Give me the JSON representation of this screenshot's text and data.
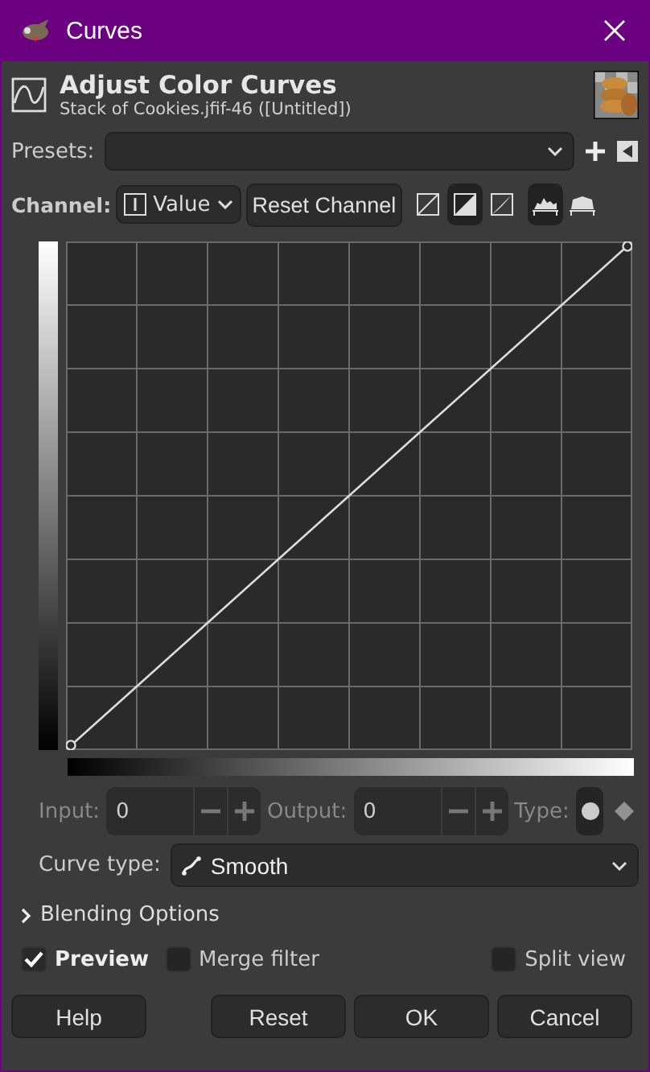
{
  "window": {
    "title": "Curves"
  },
  "header": {
    "title": "Adjust Color Curves",
    "subtitle": "Stack of Cookies.jfif-46 ([Untitled])"
  },
  "presets": {
    "label": "Presets:"
  },
  "channel": {
    "label": "Channel:",
    "value": "Value",
    "reset_button": "Reset Channel"
  },
  "curve_scale": [
    {
      "selected": false
    },
    {
      "selected": true
    },
    {
      "selected": false
    }
  ],
  "histogram_scale": [
    {
      "selected": true
    },
    {
      "selected": false
    }
  ],
  "point": {
    "disabled": true,
    "input_label": "Input:",
    "input_value": "0",
    "output_label": "Output:",
    "output_value": "0",
    "type_label": "Type:",
    "types": [
      {
        "selected": true
      },
      {
        "selected": false
      }
    ]
  },
  "curve_type": {
    "label": "Curve type:",
    "value": "Smooth"
  },
  "blending": {
    "label": "Blending Options",
    "expanded": false
  },
  "options": [
    {
      "label": "Preview",
      "checked": true
    },
    {
      "label": "Merge filter",
      "checked": false
    },
    {
      "label": "Split view",
      "checked": false
    }
  ],
  "buttons": [
    "Help",
    "Reset",
    "OK",
    "Cancel"
  ]
}
